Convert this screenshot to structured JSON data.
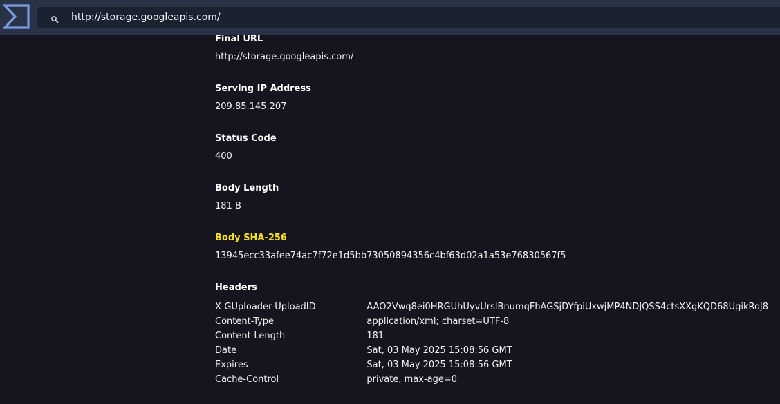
{
  "toolbar": {
    "logo_icon": "sigma-logo-icon",
    "search_icon": "search-icon",
    "url": "http://storage.googleapis.com/"
  },
  "fields": {
    "final_url": {
      "label": "Final URL",
      "value": "http://storage.googleapis.com/"
    },
    "serving_ip": {
      "label": "Serving IP Address",
      "value": "209.85.145.207"
    },
    "status_code": {
      "label": "Status Code",
      "value": "400"
    },
    "body_length": {
      "label": "Body Length",
      "value": "181 B"
    },
    "body_sha256": {
      "label": "Body SHA-256",
      "value": "13945ecc33afee74ac7f72e1d5bb73050894356c4bf63d02a1a53e76830567f5"
    }
  },
  "headers": {
    "label": "Headers",
    "rows": [
      {
        "name": "X-GUploader-UploadID",
        "value": "AAO2Vwq8ei0HRGUhUyvUrslBnumqFhAGSjDYfpiUxwjMP4NDJQSS4ctsXXgKQD68UgikRoJ8"
      },
      {
        "name": "Content-Type",
        "value": "application/xml; charset=UTF-8"
      },
      {
        "name": "Content-Length",
        "value": "181"
      },
      {
        "name": "Date",
        "value": "Sat, 03 May 2025 15:08:56 GMT"
      },
      {
        "name": "Expires",
        "value": "Sat, 03 May 2025 15:08:56 GMT"
      },
      {
        "name": "Cache-Control",
        "value": "private, max-age=0"
      }
    ]
  },
  "colors": {
    "background": "#16151f",
    "topbar": "#283348",
    "searchbar": "#1a2232",
    "logo": "#7b9be0",
    "highlight": "#f5e020"
  }
}
